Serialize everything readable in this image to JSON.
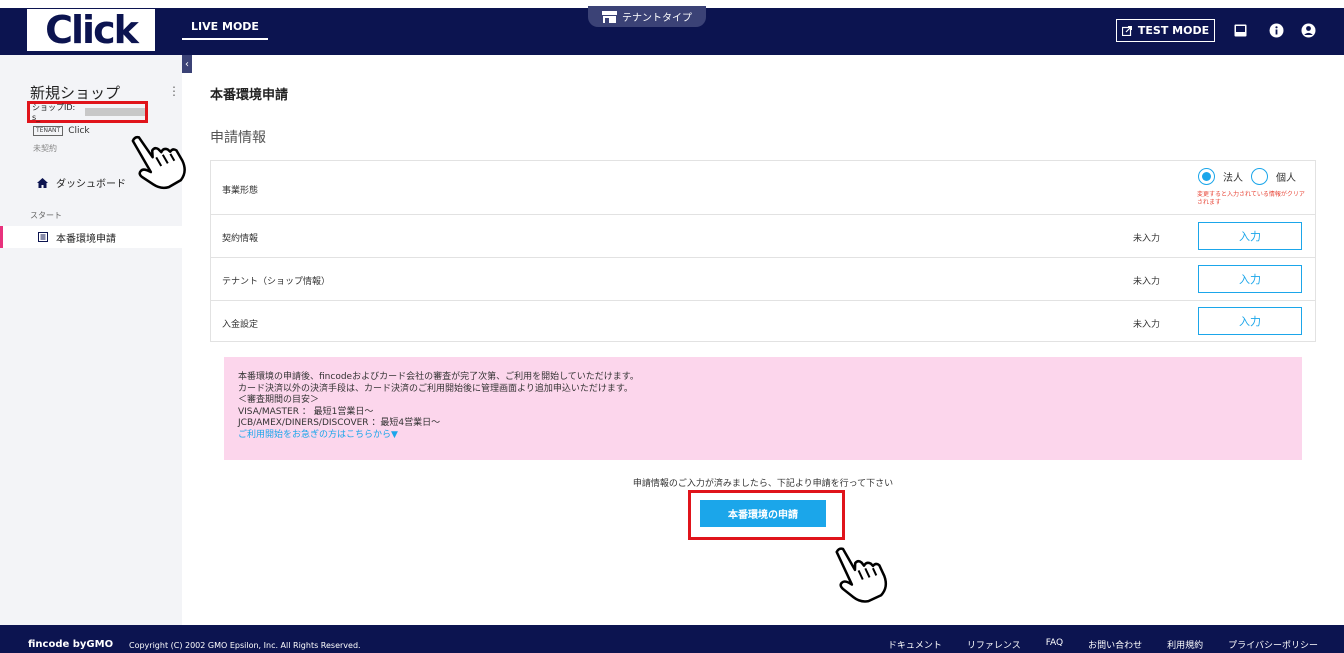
{
  "header": {
    "logo_text": "Click",
    "mode_tab": "LIVE MODE",
    "tenant_type": "テナントタイプ",
    "test_mode": "TEST MODE",
    "colors": {
      "navy": "#0c1450",
      "accent": "#1ba6ea",
      "highlight": "#e0141b"
    }
  },
  "sidebar": {
    "shop_name": "新規ショップ",
    "shop_id_label": "ショップID: s_",
    "tenant_badge": "TENANT",
    "tenant_name": "Click",
    "contract_status": "未契約",
    "dashboard": "ダッシュボード",
    "section_start": "スタート",
    "nav_apply": "本番環境申請"
  },
  "main": {
    "page_title": "本番環境申請",
    "section_title": "申請情報",
    "business_type": {
      "label": "事業形態",
      "options": [
        "法人",
        "個人"
      ],
      "selected": "法人",
      "note": "変更すると入力されている情報がクリアされます"
    },
    "rows": [
      {
        "label": "契約情報",
        "status": "未入力",
        "button": "入力"
      },
      {
        "label": "テナント（ショップ情報）",
        "status": "未入力",
        "button": "入力"
      },
      {
        "label": "入金設定",
        "status": "未入力",
        "button": "入力"
      }
    ],
    "notice": {
      "lines": [
        "本番環境の申請後、fincodeおよびカード会社の審査が完了次第、ご利用を開始していただけます。",
        "カード決済以外の決済手段は、カード決済のご利用開始後に管理画面より追加申込いただけます。",
        "＜審査期間の目安＞",
        "VISA/MASTER ： 最短1営業日〜",
        "JCB/AMEX/DINERS/DISCOVER ：最短4営業日〜"
      ],
      "link": "ご利用開始をお急ぎの方はこちらから▼"
    },
    "instruction": "申請情報のご入力が済みましたら、下記より申請を行って下さい",
    "apply_button": "本番環境の申請"
  },
  "footer": {
    "brand": "fincode byGMO",
    "copyright": "Copyright (C) 2002 GMO Epsilon, Inc. All Rights Reserved.",
    "links": [
      "ドキュメント",
      "リファレンス",
      "FAQ",
      "お問い合わせ",
      "利用規約",
      "プライバシーポリシー"
    ]
  }
}
